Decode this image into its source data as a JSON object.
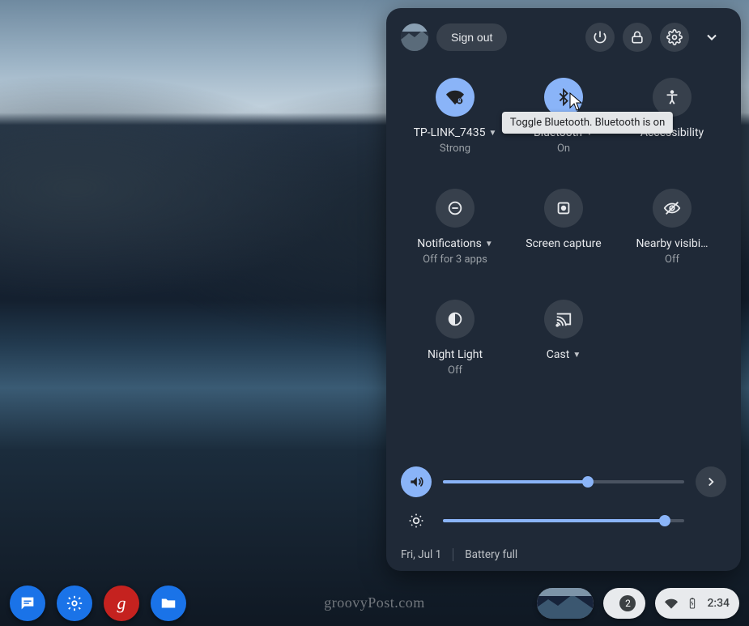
{
  "header": {
    "signout_label": "Sign out"
  },
  "tiles": {
    "wifi": {
      "label": "TP-LINK_7435",
      "sub": "Strong",
      "has_caret": true,
      "on": true
    },
    "bluetooth": {
      "label": "Bluetooth",
      "sub": "On",
      "has_caret": true,
      "on": true,
      "tooltip": "Toggle Bluetooth. Bluetooth is on"
    },
    "accessibility": {
      "label": "Accessibility",
      "sub": "",
      "has_caret": false,
      "on": false
    },
    "notifications": {
      "label": "Notifications",
      "sub": "Off for 3 apps",
      "has_caret": true,
      "on": false
    },
    "screencap": {
      "label": "Screen capture",
      "sub": "",
      "has_caret": false,
      "on": false
    },
    "nearby": {
      "label": "Nearby visibi…",
      "sub": "Off",
      "has_caret": false,
      "on": false
    },
    "nightlight": {
      "label": "Night Light",
      "sub": "Off",
      "has_caret": false,
      "on": false
    },
    "cast": {
      "label": "Cast",
      "sub": "",
      "has_caret": true,
      "on": false
    }
  },
  "sliders": {
    "volume_pct": 60,
    "brightness_pct": 92
  },
  "footer": {
    "date": "Fri, Jul 1",
    "battery": "Battery full"
  },
  "shelf": {
    "notifications_count": "2",
    "clock": "2:34"
  },
  "watermark": "groovyPost.com"
}
